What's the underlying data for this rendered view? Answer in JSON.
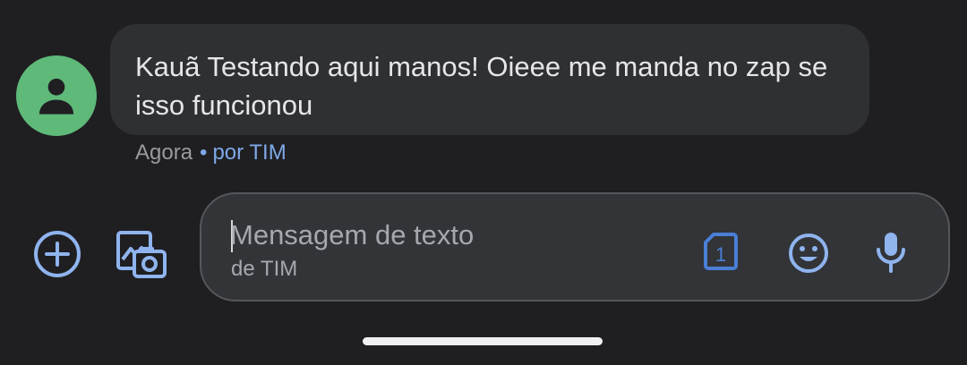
{
  "message": {
    "sender_avatar": "person-icon",
    "text": "Kauã Testando aqui manos! Oieee me manda no zap se isso funcionou",
    "time": "Agora",
    "separator": "•",
    "carrier": "por TIM"
  },
  "composer": {
    "placeholder": "Mensagem de texto",
    "sub_label": "de TIM",
    "sim_slot": "1",
    "icons": [
      "add-circle-icon",
      "gallery-camera-icon",
      "sim-card-icon",
      "emoji-icon",
      "microphone-icon"
    ]
  },
  "colors": {
    "background": "#1f1f22",
    "bubble": "#2f3033",
    "avatar": "#5fb978",
    "accent": "#7fa8e8",
    "sim_accent": "#4a7fd6"
  }
}
